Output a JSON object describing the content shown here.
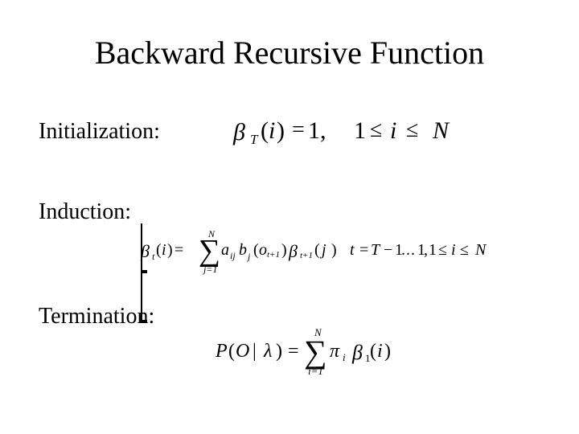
{
  "title": "Backward Recursive Function",
  "labels": {
    "initialization": "Initialization:",
    "induction": "Induction:",
    "termination": "Termination:"
  },
  "formulas": {
    "initialization": {
      "beta": "β",
      "subT": "T",
      "open": "(",
      "i": "i",
      "close": ")",
      "eq": "=",
      "one": "1",
      "comma": ",",
      "r1": "1",
      "le": "≤",
      "ri": "i",
      "rN": "N"
    },
    "induction": {
      "beta": "β",
      "t": "t",
      "open": "(",
      "i": "i",
      "close": ")",
      "eq": "=",
      "sigma": "∑",
      "sigma_upper": "N",
      "sigma_lower": "j=1",
      "a": "a",
      "a_sub": "ij",
      "b": "b",
      "b_sub": "j",
      "o": "o",
      "o_sub": "t+1",
      "beta2": "β",
      "beta2_sub": "t+1",
      "j": "j",
      "cond_t": "t",
      "cond_eq": "=",
      "cond_T": "T",
      "cond_minus": "−",
      "cond_1": "1",
      "dots": "...",
      "cond_1b": "1",
      "comma": ",",
      "le": "≤",
      "ri": "i",
      "rN": "N"
    },
    "termination": {
      "P": "P",
      "open": "(",
      "O": "O",
      "bar": "|",
      "lambda": "λ",
      "close": ")",
      "eq": "=",
      "sigma": "∑",
      "sigma_upper": "N",
      "sigma_lower": "i=1",
      "pi": "π",
      "pi_sub": "i",
      "beta": "β",
      "beta_sub": "1",
      "i": "i"
    }
  }
}
